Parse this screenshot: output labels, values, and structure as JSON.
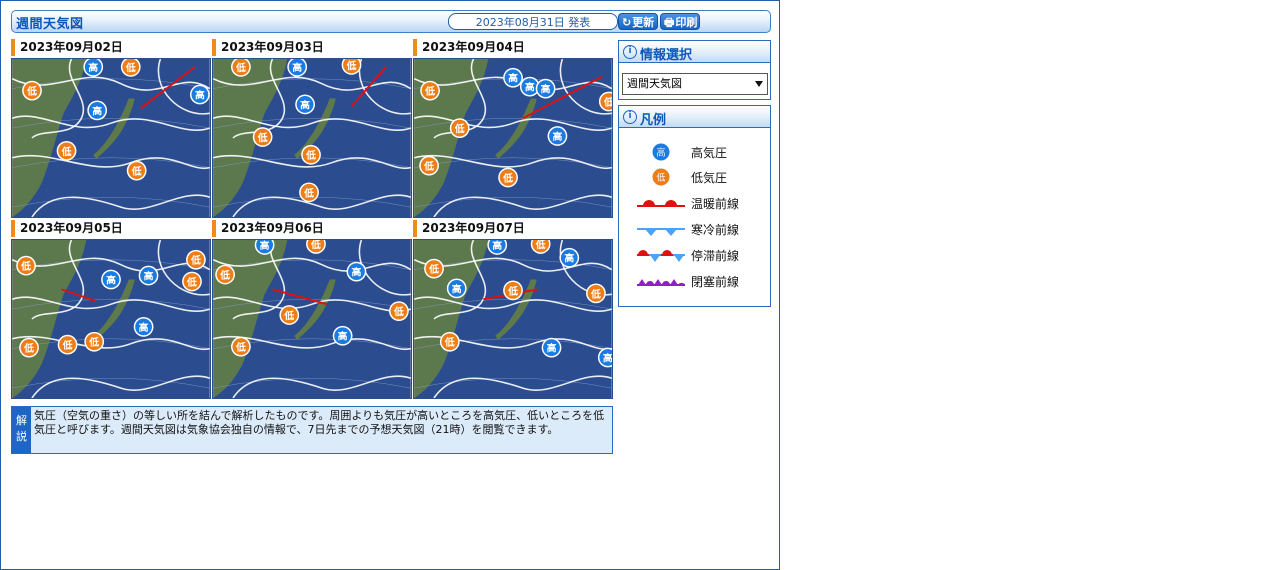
{
  "header": {
    "title": "週間天気図",
    "issued": "2023年08月31日 発表",
    "refresh_label": "更新",
    "print_label": "印刷"
  },
  "maps": [
    {
      "date": "2023年09月02日"
    },
    {
      "date": "2023年09月03日"
    },
    {
      "date": "2023年09月04日"
    },
    {
      "date": "2023年09月05日"
    },
    {
      "date": "2023年09月06日"
    },
    {
      "date": "2023年09月07日"
    }
  ],
  "symbols": {
    "high": "高",
    "low": "低"
  },
  "note": {
    "tag": "解説",
    "text": "気圧（空気の重さ）の等しい所を結んで解析したものです。周囲よりも気圧が高いところを高気圧、低いところを低気圧と呼びます。週間天気図は気象協会独自の情報で、7日先までの予想天気図（21時）を閲覧できます。"
  },
  "info_select": {
    "title": "情報選択",
    "selected": "週間天気図"
  },
  "legend": {
    "title": "凡例",
    "items": [
      {
        "label": "高気圧"
      },
      {
        "label": "低気圧"
      },
      {
        "label": "温暖前線"
      },
      {
        "label": "寒冷前線"
      },
      {
        "label": "停滞前線"
      },
      {
        "label": "閉塞前線"
      }
    ]
  },
  "colors": {
    "ocean": "#2b4d8f",
    "land": "#5f7a4a",
    "high": "#1b7be0",
    "low": "#ef7d16",
    "warm_front": "#e01010",
    "cold_front": "#4aa3f5",
    "occluded_front": "#8a22c9",
    "accent": "#1d66c8"
  }
}
